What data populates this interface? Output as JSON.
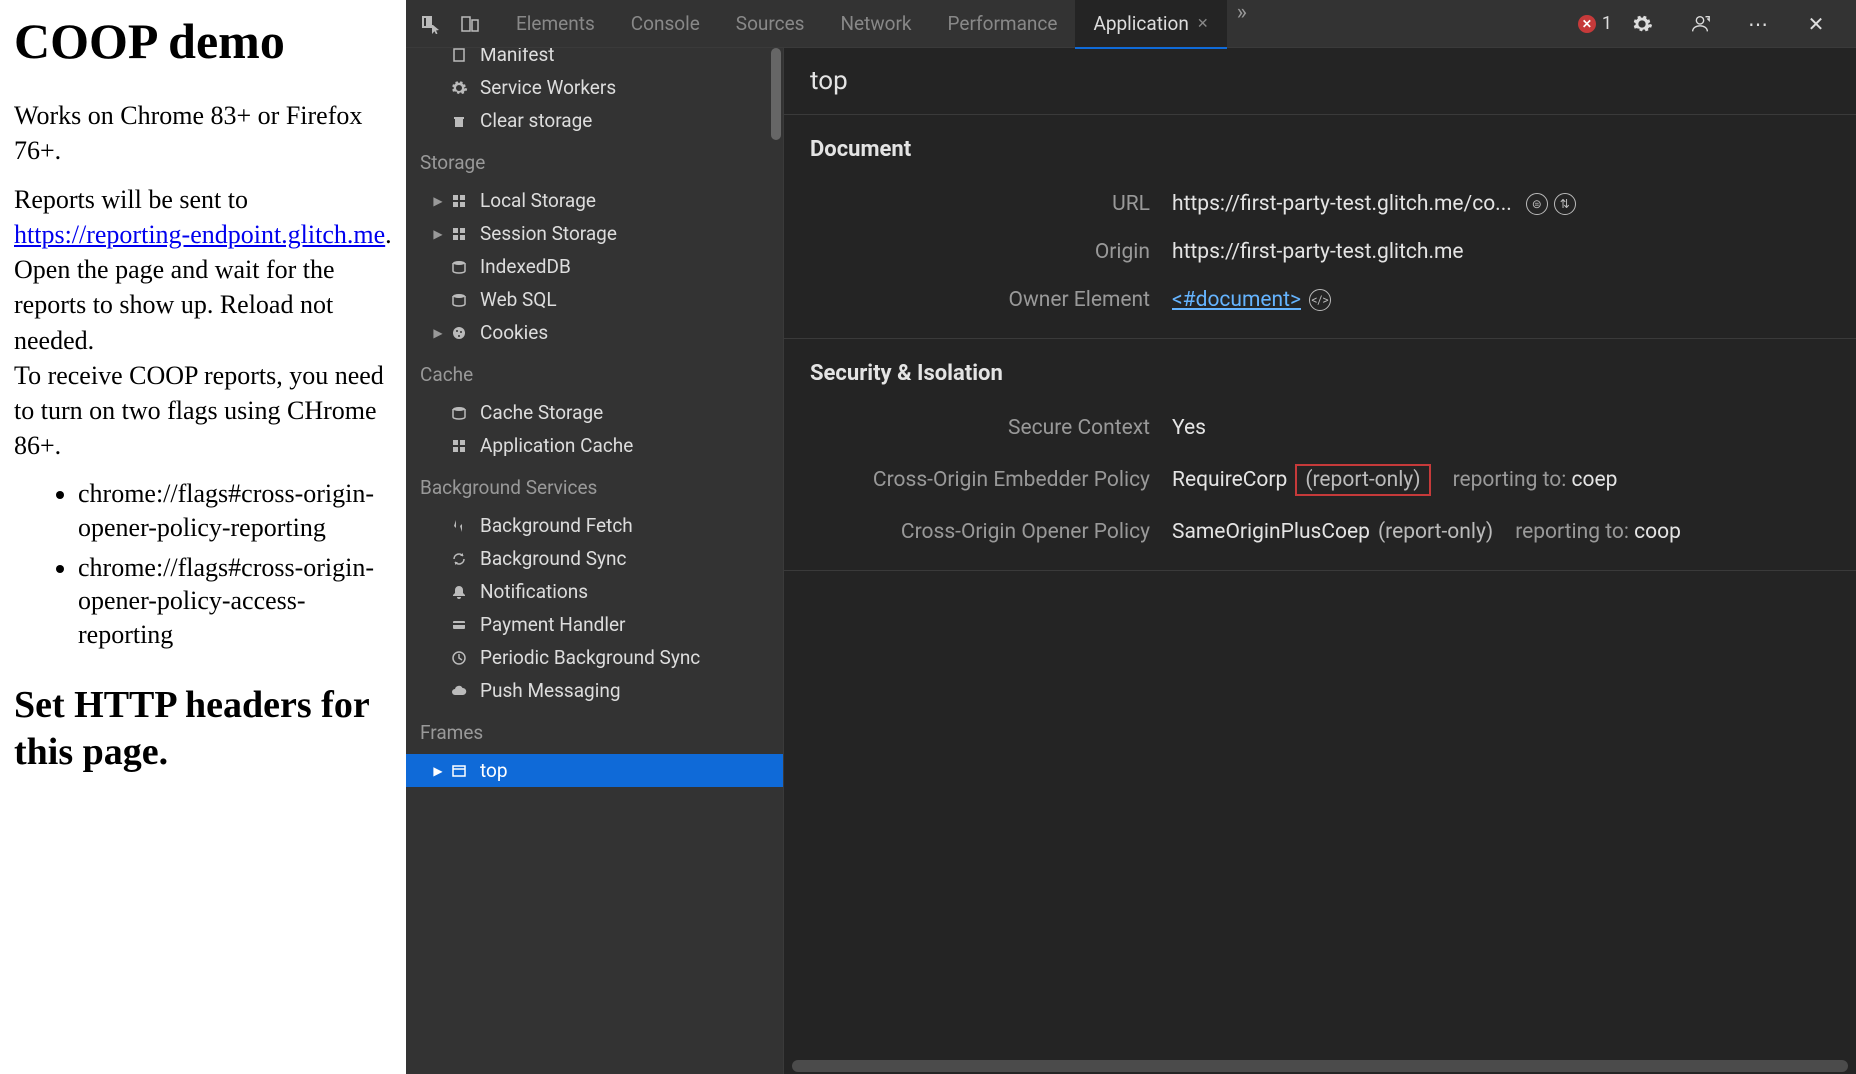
{
  "page": {
    "title": "COOP demo",
    "lead": "Works on Chrome 83+ or Firefox 76+.",
    "p1_pre": "Reports will be sent to ",
    "p1_link": "https://reporting-endpoint.glitch.me",
    "p1_post": ".",
    "p2": "Open the page and wait for the reports to show up. Reload not needed.",
    "p3": "To receive COOP reports, you need to turn on two flags using CHrome 86+.",
    "flag1": "chrome://flags#cross-origin-opener-policy-reporting",
    "flag2": "chrome://flags#cross-origin-opener-policy-access-reporting",
    "h2": "Set HTTP headers for this page."
  },
  "devtools": {
    "tabs": [
      "Elements",
      "Console",
      "Sources",
      "Network",
      "Performance",
      "Application"
    ],
    "active_tab": "Application",
    "error_count": "1"
  },
  "sidebar": {
    "app_section_cutoff": "Manifest",
    "service_workers": "Service Workers",
    "clear_storage": "Clear storage",
    "storage_label": "Storage",
    "local_storage": "Local Storage",
    "session_storage": "Session Storage",
    "indexeddb": "IndexedDB",
    "web_sql": "Web SQL",
    "cookies": "Cookies",
    "cache_label": "Cache",
    "cache_storage": "Cache Storage",
    "application_cache": "Application Cache",
    "bg_label": "Background Services",
    "bg_fetch": "Background Fetch",
    "bg_sync": "Background Sync",
    "notifications": "Notifications",
    "payment_handler": "Payment Handler",
    "periodic_bg_sync": "Periodic Background Sync",
    "push_messaging": "Push Messaging",
    "frames_label": "Frames",
    "frames_top": "top"
  },
  "main": {
    "header": "top",
    "document_title": "Document",
    "url_label": "URL",
    "url_value": "https://first-party-test.glitch.me/co...",
    "origin_label": "Origin",
    "origin_value": "https://first-party-test.glitch.me",
    "owner_label": "Owner Element",
    "owner_link": "<#document>",
    "security_title": "Security & Isolation",
    "secure_ctx_label": "Secure Context",
    "secure_ctx_value": "Yes",
    "coep_label": "Cross-Origin Embedder Policy",
    "coep_value": "RequireCorp",
    "coep_report_only": "(report-only)",
    "coep_reporting_prefix": "reporting to: ",
    "coep_reporting_to": "coep",
    "coop_label": "Cross-Origin Opener Policy",
    "coop_value": "SameOriginPlusCoep",
    "coop_report_only": "(report-only)",
    "coop_reporting_prefix": "reporting to: ",
    "coop_reporting_to": "coop"
  }
}
